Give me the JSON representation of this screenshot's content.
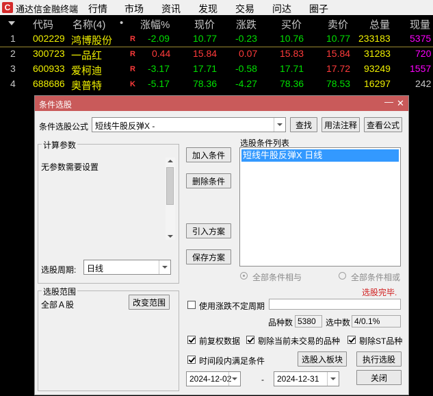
{
  "app": {
    "logo_glyph": "C",
    "name": "通达信金融终端"
  },
  "menu": [
    "行情",
    "市场",
    "资讯",
    "发现",
    "交易",
    "问达",
    "圈子"
  ],
  "table": {
    "headers": {
      "code": "代码",
      "name": "名称(4)",
      "dot": "•",
      "pct": "涨幅%",
      "price": "现价",
      "chg": "涨跌",
      "bid": "买价",
      "ask": "卖价",
      "vol": "总量",
      "cur": "现量"
    },
    "rows": [
      {
        "idx": "1",
        "code": "002229",
        "name": "鸿博股份",
        "flag": "R",
        "pct": "-2.09",
        "price": "10.77",
        "chg": "-0.23",
        "bid": "10.76",
        "ask": "10.77",
        "vol": "233183",
        "cur": "5375"
      },
      {
        "idx": "2",
        "code": "300723",
        "name": "一品红",
        "flag": "R",
        "pct": "0.44",
        "price": "15.84",
        "chg": "0.07",
        "bid": "15.83",
        "ask": "15.84",
        "vol": "31283",
        "cur": "720"
      },
      {
        "idx": "3",
        "code": "600933",
        "name": "爱柯迪",
        "flag": "R",
        "pct": "-3.17",
        "price": "17.71",
        "chg": "-0.58",
        "bid": "17.71",
        "ask": "17.72",
        "vol": "93249",
        "cur": "1557"
      },
      {
        "idx": "4",
        "code": "688686",
        "name": "奥普特",
        "flag": "K",
        "pct": "-5.17",
        "price": "78.36",
        "chg": "-4.27",
        "bid": "78.36",
        "ask": "78.53",
        "vol": "16297",
        "cur": "242"
      }
    ]
  },
  "dialog": {
    "title": "条件选股",
    "formula_label": "条件选股公式",
    "formula_value": "短线牛股反弹X -",
    "btn_find": "查找",
    "btn_usage": "用法注释",
    "btn_view": "查看公式",
    "calc_params_title": "计算参数",
    "no_params": "无参数需要设置",
    "period_label": "选股周期:",
    "period_value": "日线",
    "range_title": "选股范围",
    "range_value": "全部Ａ股",
    "btn_change_range": "改变范围",
    "btn_add": "加入条件",
    "btn_delete": "删除条件",
    "btn_import": "引入方案",
    "btn_save": "保存方案",
    "cond_list_title": "选股条件列表",
    "cond_items": [
      "短线牛股反弹X  日线"
    ],
    "radio_and": "全部条件相与",
    "radio_or": "全部条件相或",
    "status": "选股完毕.",
    "use_irregular": "使用涨跌不定周期",
    "count_label": "品种数",
    "count_value": "5380",
    "selected_label": "选中数",
    "selected_value": "4/0.1%",
    "chk_adjust": "前复权数据",
    "chk_exclude_untraded": "剔除当前未交易的品种",
    "chk_exclude_st": "剔除ST品种",
    "chk_period": "时间段内满足条件",
    "btn_to_block": "选股入板块",
    "btn_execute": "执行选股",
    "btn_close": "关闭",
    "date_from": "2024-12-02",
    "date_sep": "-",
    "date_to": "2024-12-31"
  },
  "colors": {
    "up": "#ff3b3b",
    "down": "#00e000",
    "yellow": "#ffff40",
    "code": "#f0f000",
    "magenta": "#ff00ff",
    "title_bar": "#c95a5a",
    "selection": "#3399ff"
  }
}
